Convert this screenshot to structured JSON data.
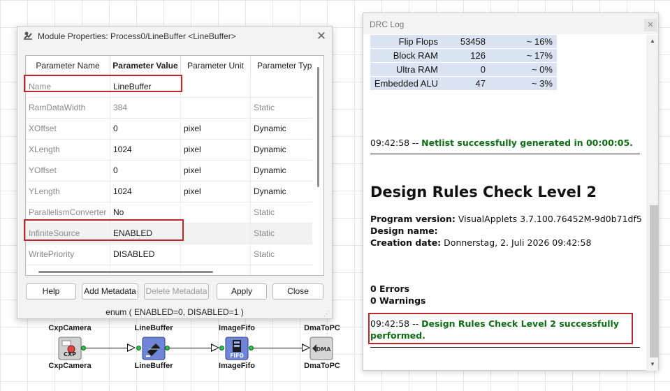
{
  "dialog": {
    "title": "Module Properties: Process0/LineBuffer <LineBuffer>",
    "close_icon": "close-icon",
    "columns": [
      "Parameter Name",
      "Parameter Value",
      "Parameter Unit",
      "Parameter Type"
    ],
    "rows": [
      {
        "name": "Name",
        "value": "LineBuffer",
        "unit": "",
        "type": ""
      },
      {
        "name": "RamDataWidth",
        "value": "384",
        "unit": "",
        "type": "Static"
      },
      {
        "name": "XOffset",
        "value": "0",
        "unit": "pixel",
        "type": "Dynamic"
      },
      {
        "name": "XLength",
        "value": "1024",
        "unit": "pixel",
        "type": "Dynamic"
      },
      {
        "name": "YOffset",
        "value": "0",
        "unit": "pixel",
        "type": "Dynamic"
      },
      {
        "name": "YLength",
        "value": "1024",
        "unit": "pixel",
        "type": "Dynamic"
      },
      {
        "name": "ParallelismConverter",
        "value": "No",
        "unit": "",
        "type": "Static"
      },
      {
        "name": "InfiniteSource",
        "value": "ENABLED",
        "unit": "",
        "type": "Static"
      },
      {
        "name": "WritePriority",
        "value": "DISABLED",
        "unit": "",
        "type": "Static"
      }
    ],
    "buttons": {
      "help": "Help",
      "add_metadata": "Add Metadata",
      "delete_metadata": "Delete Metadata",
      "apply": "Apply",
      "close": "Close"
    },
    "status": "enum ( ENABLED=0, DISABLED=1 )"
  },
  "diagram": {
    "nodes": [
      {
        "label": "CxpCamera",
        "icon": "cxp-camera-icon",
        "badge": "CXP"
      },
      {
        "label": "LineBuffer",
        "icon": "linebuffer-icon",
        "badge": ""
      },
      {
        "label": "ImageFifo",
        "icon": "fifo-icon",
        "badge": "FIFO"
      },
      {
        "label": "DmaToPC",
        "icon": "dma-icon",
        "badge": "DMA"
      }
    ]
  },
  "drc": {
    "title": "DRC Log",
    "close_icon": "close-icon",
    "resources": [
      {
        "name": "Flip Flops",
        "count": "53458",
        "pct": "~ 16%"
      },
      {
        "name": "Block RAM",
        "count": "126",
        "pct": "~ 17%"
      },
      {
        "name": "Ultra RAM",
        "count": "0",
        "pct": "~ 0%"
      },
      {
        "name": "Embedded ALU",
        "count": "47",
        "pct": "~ 3%"
      }
    ],
    "netlist_time": "09:42:58 --",
    "netlist_msg": "Netlist successfully generated in 00:00:05.",
    "heading": "Design Rules Check Level 2",
    "program_version_label": "Program version:",
    "program_version": "VisualApplets 3.7.100.76452M-9d0b71df5",
    "design_name_label": "Design name:",
    "design_name": "",
    "creation_date_label": "Creation date:",
    "creation_date": "Donnerstag, 2. Juli 2026 09:42:58",
    "errors": "0 Errors",
    "warnings": "0 Warnings",
    "result_time": "09:42:58 --",
    "result_msg_1": "Design Rules Check Level 2 successfully",
    "result_msg_2": "performed."
  }
}
